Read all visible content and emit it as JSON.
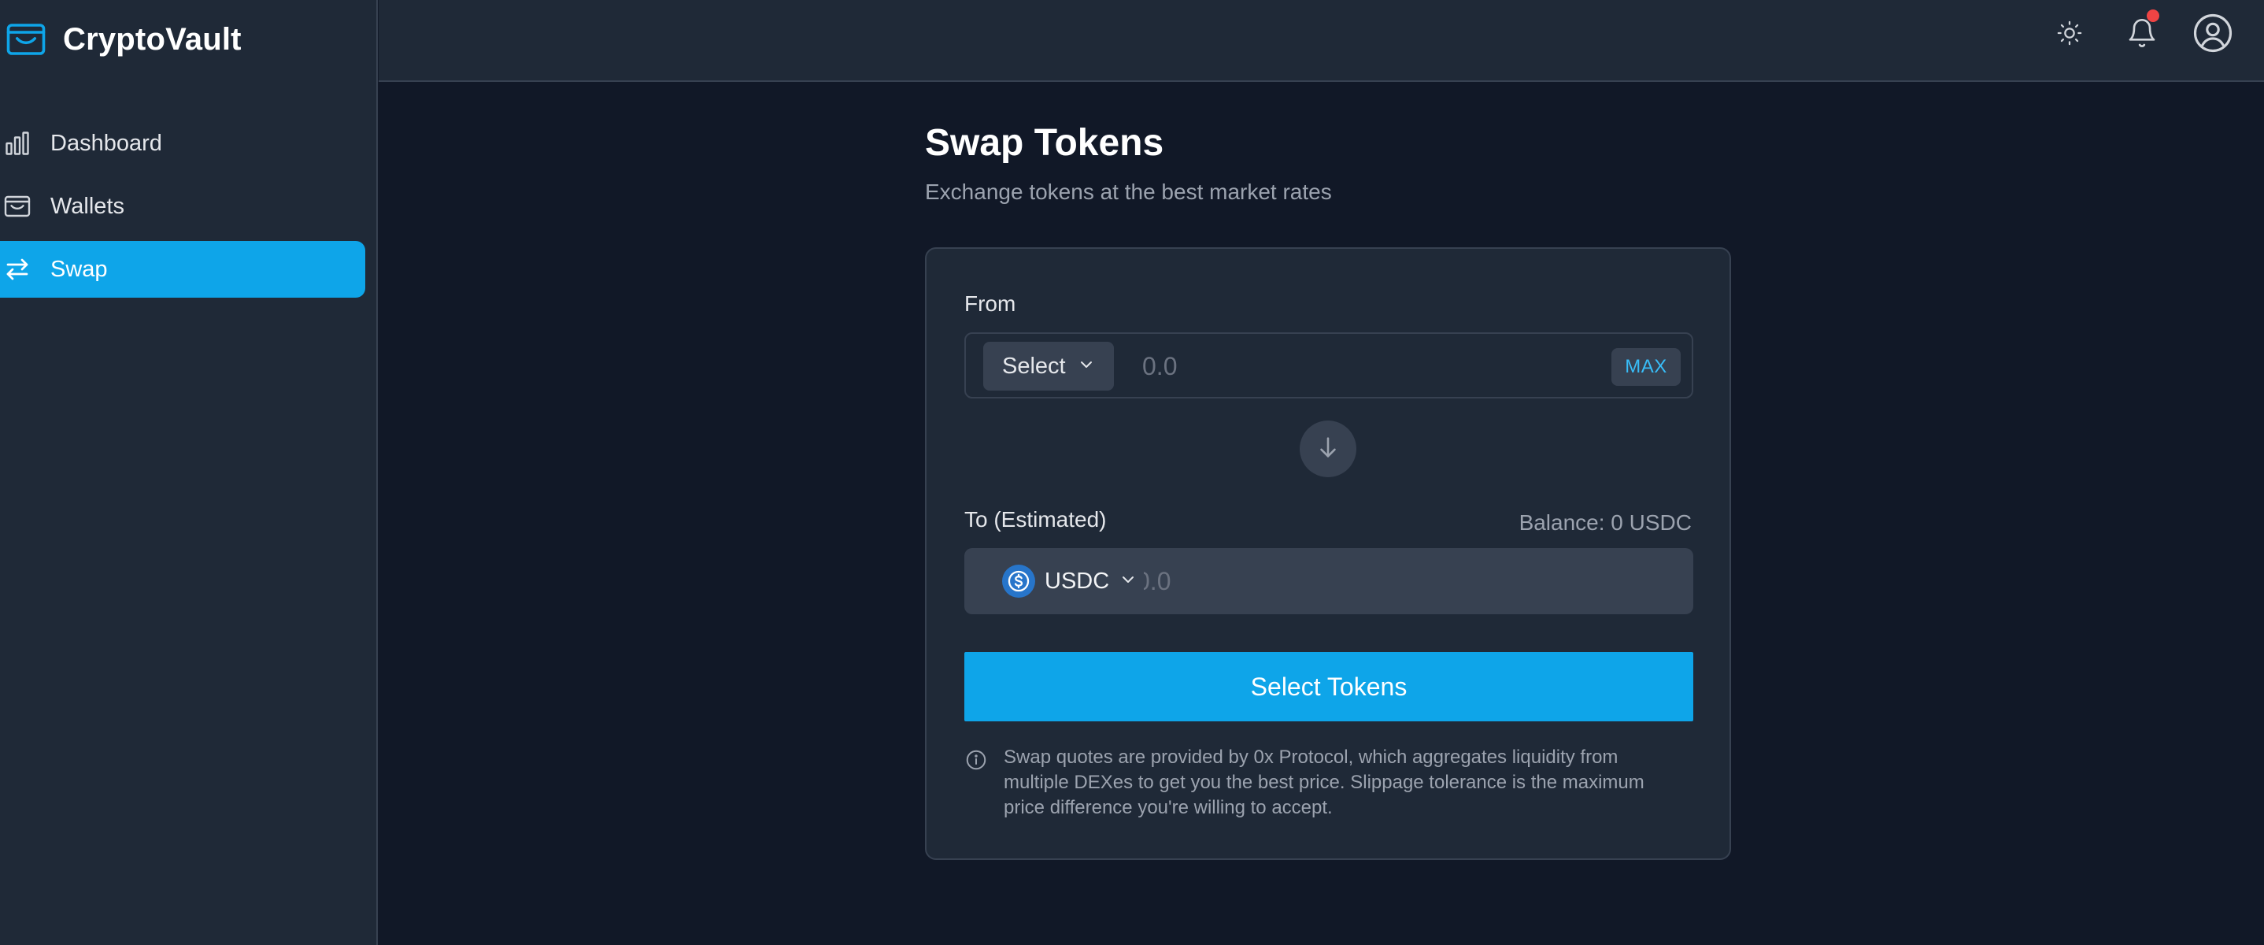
{
  "app": {
    "name": "CryptoVault"
  },
  "sidebar": {
    "items": [
      {
        "label": "Dashboard",
        "icon": "bar-chart-icon",
        "active": false
      },
      {
        "label": "Wallets",
        "icon": "wallet-icon",
        "active": false
      },
      {
        "label": "Swap",
        "icon": "swap-arrows-icon",
        "active": true
      }
    ]
  },
  "topbar": {
    "icons": [
      "sun-icon",
      "bell-icon",
      "user-circle-icon"
    ],
    "has_notification": true
  },
  "page": {
    "title": "Swap Tokens",
    "subtitle": "Exchange tokens at the best market rates"
  },
  "swap": {
    "from_label": "From",
    "from_token_select_label": "Select",
    "from_amount_placeholder": "0.0",
    "max_label": "MAX",
    "to_label": "To (Estimated)",
    "balance_text": "Balance: 0 USDC",
    "to_token_label": "USDC",
    "to_amount_placeholder": "0.0",
    "submit_label": "Select Tokens",
    "info_text": "Swap quotes are provided by 0x Protocol, which aggregates liquidity from multiple DEXes to get you the best price. Slippage tolerance is the maximum price difference you're willing to accept."
  },
  "colors": {
    "accent": "#0ea5e9",
    "background": "#111827",
    "surface": "#1f2937",
    "notification": "#ef4444",
    "usdc": "#2775ca"
  }
}
